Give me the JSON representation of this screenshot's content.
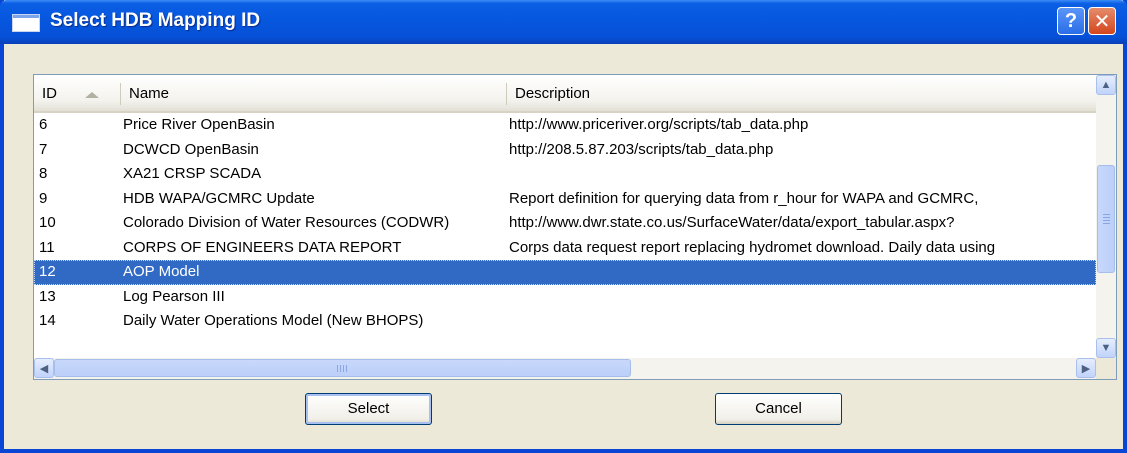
{
  "window": {
    "title": "Select HDB Mapping ID",
    "help_label": "?",
    "close_label": "✕"
  },
  "table": {
    "columns": [
      "ID",
      "Name",
      "Description"
    ],
    "sort_column": "ID",
    "rows": [
      {
        "id": "6",
        "name": "Price River OpenBasin",
        "description": "http://www.priceriver.org/scripts/tab_data.php"
      },
      {
        "id": "7",
        "name": "DCWCD OpenBasin",
        "description": "http://208.5.87.203/scripts/tab_data.php"
      },
      {
        "id": "8",
        "name": "XA21 CRSP SCADA",
        "description": ""
      },
      {
        "id": "9",
        "name": "HDB WAPA/GCMRC Update",
        "description": "Report definition for querying data from r_hour for WAPA and GCMRC,"
      },
      {
        "id": "10",
        "name": "Colorado Division of Water Resources (CODWR)",
        "description": "http://www.dwr.state.co.us/SurfaceWater/data/export_tabular.aspx?"
      },
      {
        "id": "11",
        "name": "CORPS OF ENGINEERS DATA REPORT",
        "description": "Corps data request report replacing hydromet download.  Daily data using"
      },
      {
        "id": "12",
        "name": "AOP Model",
        "description": "",
        "selected": true
      },
      {
        "id": "13",
        "name": "Log Pearson III",
        "description": ""
      },
      {
        "id": "14",
        "name": "Daily Water Operations Model (New BHOPS)",
        "description": ""
      }
    ]
  },
  "scrollbars": {
    "up_icon": "▲",
    "down_icon": "▼",
    "left_icon": "◀",
    "right_icon": "▶"
  },
  "buttons": {
    "select_label": "Select",
    "cancel_label": "Cancel"
  }
}
